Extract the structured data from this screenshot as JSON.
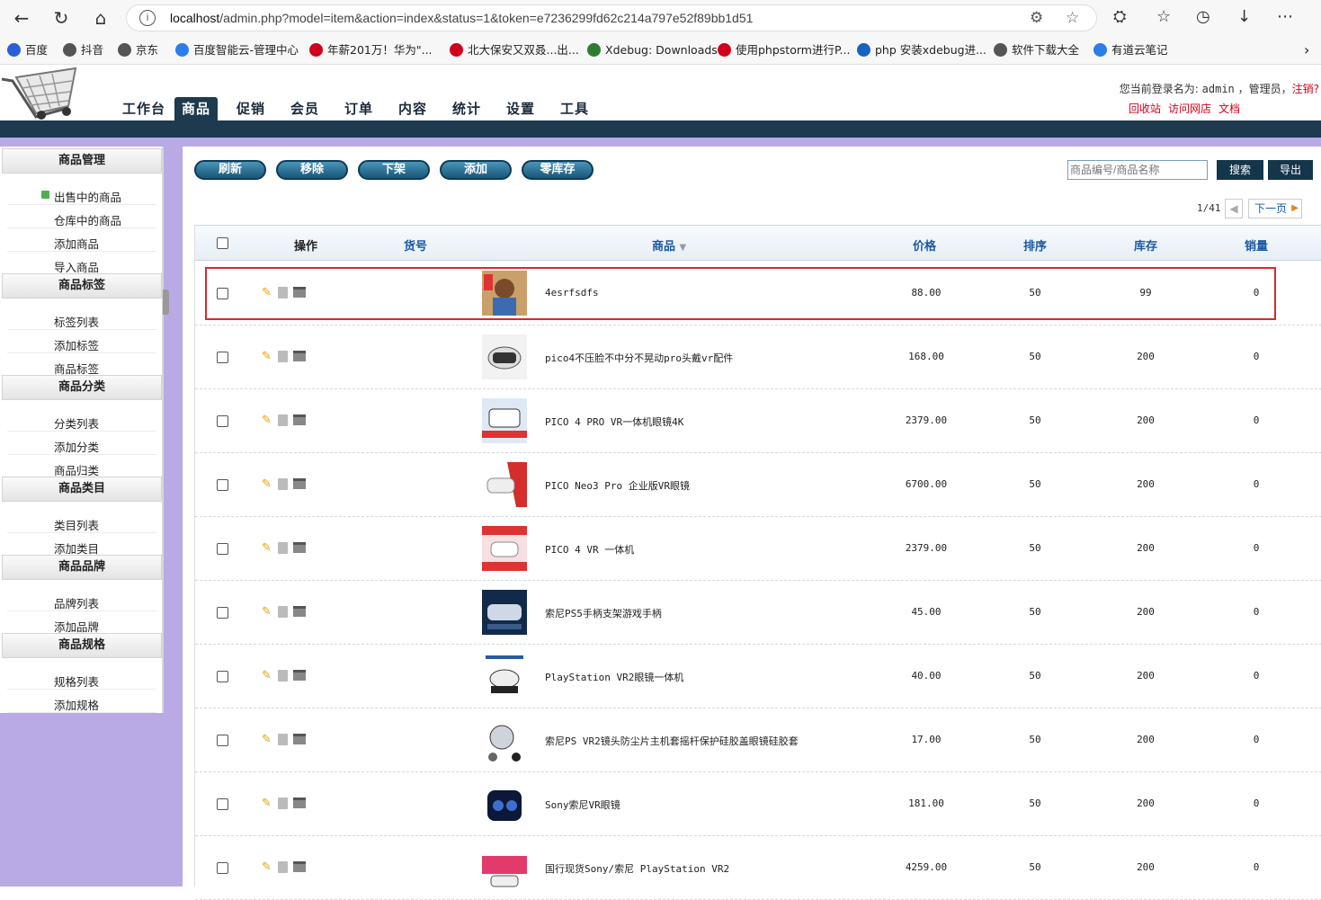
{
  "browser": {
    "url_host": "localhost",
    "url_path": "/admin.php?model=item&action=index&status=1&token=e7236299fd62c214a797e52f89bb1d51"
  },
  "bookmarks": [
    {
      "label": "百度",
      "color": "#2b5fd9"
    },
    {
      "label": "抖音",
      "color": "#555555"
    },
    {
      "label": "京东",
      "color": "#555555"
    },
    {
      "label": "百度智能云-管理中心",
      "color": "#2b7de9"
    },
    {
      "label": "年薪201万！华为\"...",
      "color": "#d0021b"
    },
    {
      "label": "北大保安又双叒...出...",
      "color": "#d0021b"
    },
    {
      "label": "Xdebug: Downloads",
      "color": "#2e7d32"
    },
    {
      "label": "使用phpstorm进行P...",
      "color": "#d0021b"
    },
    {
      "label": "php 安装xdebug进...",
      "color": "#1565c0"
    },
    {
      "label": "软件下载大全",
      "color": "#555555"
    },
    {
      "label": "有道云笔记",
      "color": "#2b7de9"
    }
  ],
  "nav": {
    "items": [
      "工作台",
      "商品",
      "促销",
      "会员",
      "订单",
      "内容",
      "统计",
      "设置",
      "工具"
    ],
    "active": "商品"
  },
  "user": {
    "prefix": "您当前登录名为:",
    "name": "admin",
    "role": "，管理员，",
    "logout": "注销?",
    "links": [
      "回收站",
      "访问网店",
      "文档"
    ]
  },
  "sidebar": {
    "groups": [
      {
        "title": "商品管理",
        "items": [
          "出售中的商品",
          "仓库中的商品",
          "添加商品",
          "导入商品"
        ]
      },
      {
        "title": "商品标签",
        "items": [
          "标签列表",
          "添加标签",
          "商品标签"
        ]
      },
      {
        "title": "商品分类",
        "items": [
          "分类列表",
          "添加分类",
          "商品归类"
        ]
      },
      {
        "title": "商品类目",
        "items": [
          "类目列表",
          "添加类目"
        ]
      },
      {
        "title": "商品品牌",
        "items": [
          "品牌列表",
          "添加品牌"
        ]
      },
      {
        "title": "商品规格",
        "items": [
          "规格列表",
          "添加规格"
        ]
      }
    ]
  },
  "toolbar": {
    "buttons": [
      "刷新",
      "移除",
      "下架",
      "添加",
      "零库存"
    ],
    "search_placeholder": "商品编号/商品名称",
    "search_label": "搜索",
    "export_label": "导出"
  },
  "pager": {
    "page": "1/41",
    "next": "下一页"
  },
  "table": {
    "headers": {
      "op": "操作",
      "sku": "货号",
      "name": "商品",
      "price": "价格",
      "sort": "排序",
      "stock": "库存",
      "sales": "销量"
    },
    "rows": [
      {
        "name": "4esrfsdfs",
        "price": "88.00",
        "sort": "50",
        "stock": "99",
        "sales": "0"
      },
      {
        "name": "pico4不压脸不中分不晃动pro头戴vr配件",
        "price": "168.00",
        "sort": "50",
        "stock": "200",
        "sales": "0"
      },
      {
        "name": "PICO 4 PRO VR一体机眼镜4K",
        "price": "2379.00",
        "sort": "50",
        "stock": "200",
        "sales": "0"
      },
      {
        "name": "PICO Neo3 Pro 企业版VR眼镜",
        "price": "6700.00",
        "sort": "50",
        "stock": "200",
        "sales": "0"
      },
      {
        "name": "PICO 4 VR 一体机",
        "price": "2379.00",
        "sort": "50",
        "stock": "200",
        "sales": "0"
      },
      {
        "name": "索尼PS5手柄支架游戏手柄",
        "price": "45.00",
        "sort": "50",
        "stock": "200",
        "sales": "0"
      },
      {
        "name": "PlayStation VR2眼镜一体机",
        "price": "40.00",
        "sort": "50",
        "stock": "200",
        "sales": "0"
      },
      {
        "name": "索尼PS VR2镜头防尘片主机套摇杆保护硅胶盖眼镜硅胶套",
        "price": "17.00",
        "sort": "50",
        "stock": "200",
        "sales": "0"
      },
      {
        "name": "Sony索尼VR眼镜",
        "price": "181.00",
        "sort": "50",
        "stock": "200",
        "sales": "0"
      },
      {
        "name": "国行现货Sony/索尼 PlayStation VR2",
        "price": "4259.00",
        "sort": "50",
        "stock": "200",
        "sales": "0"
      }
    ]
  }
}
